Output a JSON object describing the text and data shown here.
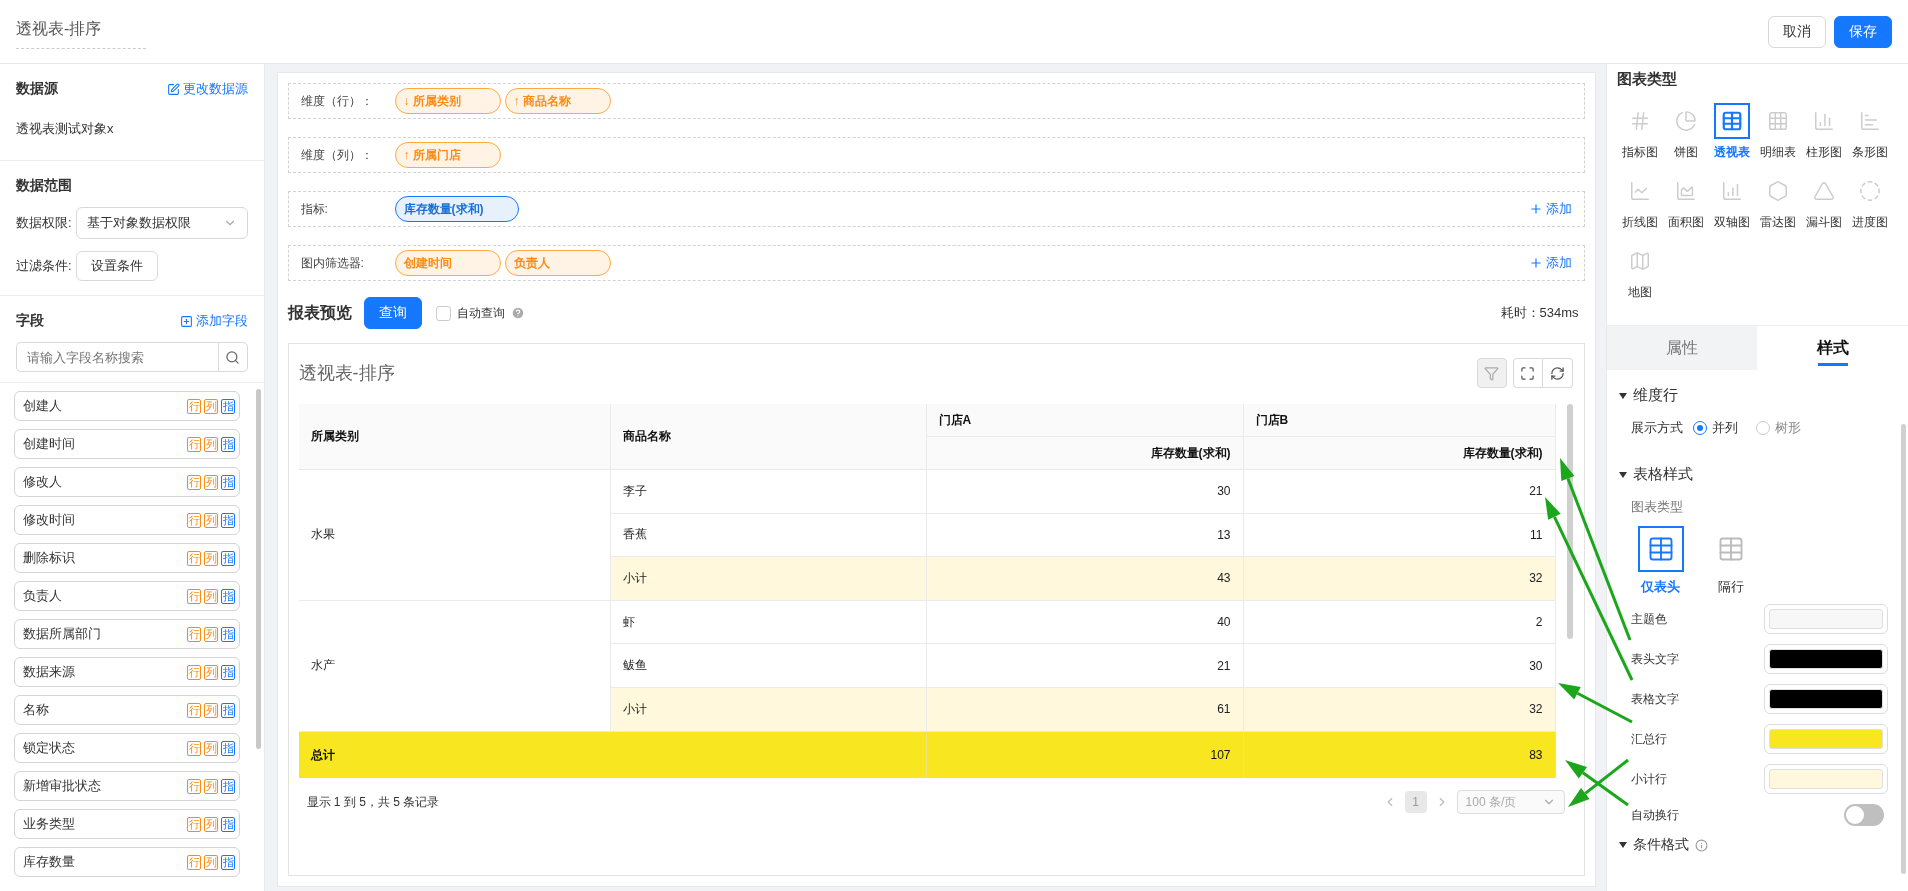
{
  "header": {
    "title": "透视表-排序",
    "buttons": [
      {
        "label": "取消",
        "kind": "default"
      },
      {
        "label": "保存",
        "kind": "primary"
      }
    ]
  },
  "sidebar": {
    "datasource": {
      "title": "数据源",
      "action": "更改数据源",
      "value": "透视表测试对象x"
    },
    "range": {
      "title": "数据范围",
      "permission_label": "数据权限:",
      "permission_value": "基于对象数据权限",
      "filter_label": "过滤条件:",
      "filter_button": "设置条件"
    },
    "fields": {
      "title": "字段",
      "action": "添加字段",
      "search_placeholder": "请输入字段名称搜索",
      "items": [
        {
          "label": "创建人",
          "tags": [
            {
              "text": "行",
              "color": "#fa8c16"
            },
            {
              "text": "列",
              "color": "#fa8c16"
            },
            {
              "text": "指",
              "color": "#1677ff"
            }
          ]
        },
        {
          "label": "创建时间",
          "tags": [
            {
              "text": "行",
              "color": "#fa8c16"
            },
            {
              "text": "列",
              "color": "#fa8c16"
            },
            {
              "text": "指",
              "color": "#1677ff"
            }
          ]
        },
        {
          "label": "修改人",
          "tags": [
            {
              "text": "行",
              "color": "#fa8c16"
            },
            {
              "text": "列",
              "color": "#fa8c16"
            },
            {
              "text": "指",
              "color": "#1677ff"
            }
          ]
        },
        {
          "label": "修改时间",
          "tags": [
            {
              "text": "行",
              "color": "#fa8c16"
            },
            {
              "text": "列",
              "color": "#fa8c16"
            },
            {
              "text": "指",
              "color": "#1677ff"
            }
          ]
        },
        {
          "label": "删除标识",
          "tags": [
            {
              "text": "行",
              "color": "#fa8c16"
            },
            {
              "text": "列",
              "color": "#fa8c16"
            },
            {
              "text": "指",
              "color": "#1677ff"
            }
          ]
        },
        {
          "label": "负责人",
          "tags": [
            {
              "text": "行",
              "color": "#fa8c16"
            },
            {
              "text": "列",
              "color": "#fa8c16"
            },
            {
              "text": "指",
              "color": "#1677ff"
            }
          ]
        },
        {
          "label": "数据所属部门",
          "tags": [
            {
              "text": "行",
              "color": "#fa8c16"
            },
            {
              "text": "列",
              "color": "#fa8c16"
            },
            {
              "text": "指",
              "color": "#1677ff"
            }
          ]
        },
        {
          "label": "数据来源",
          "tags": [
            {
              "text": "行",
              "color": "#fa8c16"
            },
            {
              "text": "列",
              "color": "#fa8c16"
            },
            {
              "text": "指",
              "color": "#1677ff"
            }
          ]
        },
        {
          "label": "名称",
          "tags": [
            {
              "text": "行",
              "color": "#fa8c16"
            },
            {
              "text": "列",
              "color": "#fa8c16"
            },
            {
              "text": "指",
              "color": "#1677ff"
            }
          ]
        },
        {
          "label": "锁定状态",
          "tags": [
            {
              "text": "行",
              "color": "#fa8c16"
            },
            {
              "text": "列",
              "color": "#fa8c16"
            },
            {
              "text": "指",
              "color": "#1677ff"
            }
          ]
        },
        {
          "label": "新增审批状态",
          "tags": [
            {
              "text": "行",
              "color": "#fa8c16"
            },
            {
              "text": "列",
              "color": "#fa8c16"
            },
            {
              "text": "指",
              "color": "#1677ff"
            }
          ]
        },
        {
          "label": "业务类型",
          "tags": [
            {
              "text": "行",
              "color": "#fa8c16"
            },
            {
              "text": "列",
              "color": "#fa8c16"
            },
            {
              "text": "指",
              "color": "#1677ff"
            }
          ]
        },
        {
          "label": "库存数量",
          "tags": [
            {
              "text": "行",
              "color": "#fa8c16"
            },
            {
              "text": "列",
              "color": "#fa8c16"
            },
            {
              "text": "指",
              "color": "#1677ff"
            }
          ]
        }
      ]
    }
  },
  "config": [
    {
      "label": "维度（行）：",
      "chips": [
        {
          "label": "所属类别",
          "arrow": "↓",
          "kind": "dimension"
        },
        {
          "label": "商品名称",
          "arrow": "↑",
          "kind": "dimension"
        }
      ]
    },
    {
      "label": "维度（列）：",
      "chips": [
        {
          "label": "所属门店",
          "arrow": "↑",
          "kind": "dimension"
        }
      ]
    },
    {
      "label": "指标:",
      "chips": [
        {
          "label": "库存数量(求和)",
          "kind": "measure"
        }
      ],
      "add": "添加"
    },
    {
      "label": "图内筛选器:",
      "chips": [
        {
          "label": "创建时间",
          "kind": "dimension"
        },
        {
          "label": "负责人",
          "kind": "dimension"
        }
      ],
      "add": "添加"
    }
  ],
  "preview": {
    "title": "报表预览",
    "query_button": "查询",
    "auto_query": {
      "label": "自动查询",
      "checked": false
    },
    "elapsed": "耗时：534ms",
    "card_title": "透视表-排序",
    "table": {
      "row_headers": [
        "所属类别",
        "商品名称"
      ],
      "column_groups": [
        {
          "label": "门店A",
          "measure": "库存数量(求和)"
        },
        {
          "label": "门店B",
          "measure": "库存数量(求和)"
        }
      ],
      "groups": [
        {
          "category": "水果",
          "rows": [
            {
              "name": "李子",
              "values": [
                "30",
                "21"
              ],
              "kind": "item"
            },
            {
              "name": "香蕉",
              "values": [
                "13",
                "11"
              ],
              "kind": "item"
            },
            {
              "name": "小计",
              "values": [
                "43",
                "32"
              ],
              "kind": "subtotal"
            }
          ]
        },
        {
          "category": "水产",
          "rows": [
            {
              "name": "虾",
              "values": [
                "40",
                "2"
              ],
              "kind": "item"
            },
            {
              "name": "鲅鱼",
              "values": [
                "21",
                "30"
              ],
              "kind": "item"
            },
            {
              "name": "小计",
              "values": [
                "61",
                "32"
              ],
              "kind": "subtotal"
            }
          ]
        }
      ],
      "total": {
        "label": "总计",
        "values": [
          "107",
          "83"
        ]
      }
    },
    "footer": {
      "summary": "显示 1 到 5，共 5 条记录",
      "page": "1",
      "page_size": "100 条/页"
    }
  },
  "panel": {
    "chart_types_title": "图表类型",
    "chart_types": [
      {
        "label": "指标图",
        "selected": false
      },
      {
        "label": "饼图",
        "selected": false
      },
      {
        "label": "透视表",
        "selected": true
      },
      {
        "label": "明细表",
        "selected": false
      },
      {
        "label": "柱形图",
        "selected": false
      },
      {
        "label": "条形图",
        "selected": false
      },
      {
        "label": "折线图",
        "selected": false
      },
      {
        "label": "面积图",
        "selected": false
      },
      {
        "label": "双轴图",
        "selected": false
      },
      {
        "label": "雷达图",
        "selected": false
      },
      {
        "label": "漏斗图",
        "selected": false
      },
      {
        "label": "进度图",
        "selected": false
      },
      {
        "label": "地图",
        "selected": false
      }
    ],
    "tabs": [
      {
        "label": "属性",
        "selected": false
      },
      {
        "label": "样式",
        "selected": true
      }
    ],
    "dimension_section": {
      "title": "维度行",
      "label": "展示方式",
      "options": [
        {
          "label": "并列",
          "selected": true
        },
        {
          "label": "树形",
          "selected": false
        }
      ]
    },
    "table_section": {
      "title": "表格样式",
      "style_label": "图表类型",
      "styles": [
        {
          "label": "仅表头",
          "selected": true
        },
        {
          "label": "隔行",
          "selected": false
        }
      ],
      "colors": [
        {
          "label": "主题色",
          "color": "#f7f7f7"
        },
        {
          "label": "表头文字",
          "color": "#000000"
        },
        {
          "label": "表格文字",
          "color": "#000000"
        },
        {
          "label": "汇总行",
          "color": "#f7e620"
        },
        {
          "label": "小计行",
          "color": "#fff8dc"
        }
      ],
      "wrap": {
        "label": "自动换行",
        "on": false
      }
    },
    "next_section": "条件格式"
  }
}
